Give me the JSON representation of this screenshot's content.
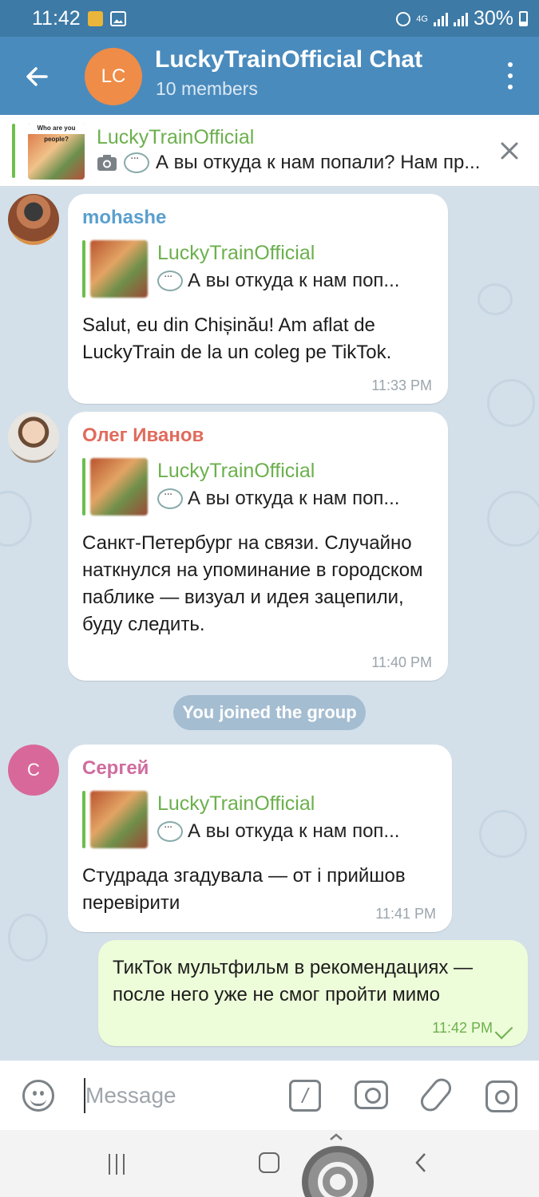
{
  "status_bar": {
    "time": "11:42",
    "network": "4G",
    "battery": "30%"
  },
  "header": {
    "avatar_initials": "LC",
    "avatar_color": "#ef8c47",
    "title": "LuckyTrainOfficial Chat",
    "subtitle": "10 members"
  },
  "pinned": {
    "thumb_caption": "Who are you people?",
    "sender": "LuckyTrainOfficial",
    "text": "А вы откуда к нам попали? Нам пр..."
  },
  "messages": [
    {
      "sender": "mohashe",
      "sender_color": "#5a9fcf",
      "reply_to": "LuckyTrainOfficial",
      "reply_text": "А вы откуда к нам поп...",
      "text": "Salut, eu din Chișinău! Am aflat de LuckyTrain de la un coleg pe TikTok.",
      "time": "11:33 PM"
    },
    {
      "sender": "Олег Иванов",
      "sender_color": "#e06b5c",
      "reply_to": "LuckyTrainOfficial",
      "reply_text": "А вы откуда к нам поп...",
      "text": "Санкт-Петербург на связи. Случайно наткнулся на упоминание в городском паблике — визуал и идея зацепили, буду следить.",
      "time": "11:40 PM"
    },
    {
      "sender": "Сергей",
      "sender_color": "#d06c9e",
      "avatar_initial": "С",
      "reply_to": "LuckyTrainOfficial",
      "reply_text": "А вы откуда к нам поп...",
      "text": "Студрада згадувала — от і прийшов перевірити",
      "time": "11:41 PM"
    }
  ],
  "service_message": "You joined the group",
  "outgoing": {
    "text": "ТикТок мультфильм в рекомендациях — после него уже не смог пройти мимо",
    "time": "11:42 PM"
  },
  "input": {
    "placeholder": "Message"
  }
}
